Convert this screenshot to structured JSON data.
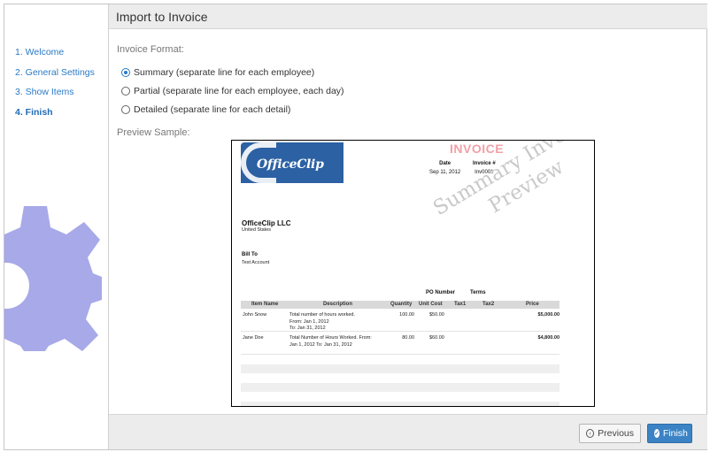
{
  "sidebar": {
    "steps": [
      {
        "label": "1. Welcome"
      },
      {
        "label": "2. General Settings"
      },
      {
        "label": "3. Show Items"
      },
      {
        "label": "4. Finish"
      }
    ],
    "gear_icon": "gear-icon"
  },
  "header": {
    "title": "Import to Invoice"
  },
  "form": {
    "format_label": "Invoice Format:",
    "options": [
      {
        "label": "Summary (separate line for each employee)",
        "checked": true
      },
      {
        "label": "Partial (separate line for each employee, each day)",
        "checked": false
      },
      {
        "label": "Detailed (separate line for each detail)",
        "checked": false
      }
    ],
    "preview_label": "Preview Sample:"
  },
  "preview": {
    "logo_text": "OfficeClip",
    "invoice_title": "INVOICE",
    "date_label": "Date",
    "date_value": "Sep 11, 2012",
    "invoice_no_label": "Invoice #",
    "invoice_no_value": "Inv0001",
    "watermark_line1": "Summary Invoice",
    "watermark_line2": "Preview",
    "company_name": "OfficeClip LLC",
    "company_country": "United States",
    "bill_to_label": "Bill To",
    "bill_to_value": "Test Account",
    "po_label": "PO Number",
    "terms_label": "Terms",
    "columns": [
      "Item Name",
      "Description",
      "Quantity",
      "Unit Cost",
      "Tax1",
      "Tax2",
      "Price"
    ],
    "rows": [
      {
        "item": "John Snow",
        "desc1": "Total number of hours worked.",
        "desc2": "From: Jan 1, 2012",
        "desc3": "To: Jan 31, 2012",
        "qty": "100.00",
        "unit": "$50.00",
        "price": "$5,000.00"
      },
      {
        "item": "Jane Doe",
        "desc1": "Total Number of Hours Worked. From:",
        "desc2": "Jan 1, 2012 To: Jan 31, 2012",
        "desc3": "",
        "qty": "80.00",
        "unit": "$60.00",
        "price": "$4,800.00"
      }
    ]
  },
  "footer": {
    "previous_label": "Previous",
    "finish_label": "Finish"
  },
  "colors": {
    "accent": "#2a7ac6",
    "finish_button": "#3b83c4",
    "gear": "#a7a9e8",
    "invoice_title": "#f2a0a8"
  }
}
